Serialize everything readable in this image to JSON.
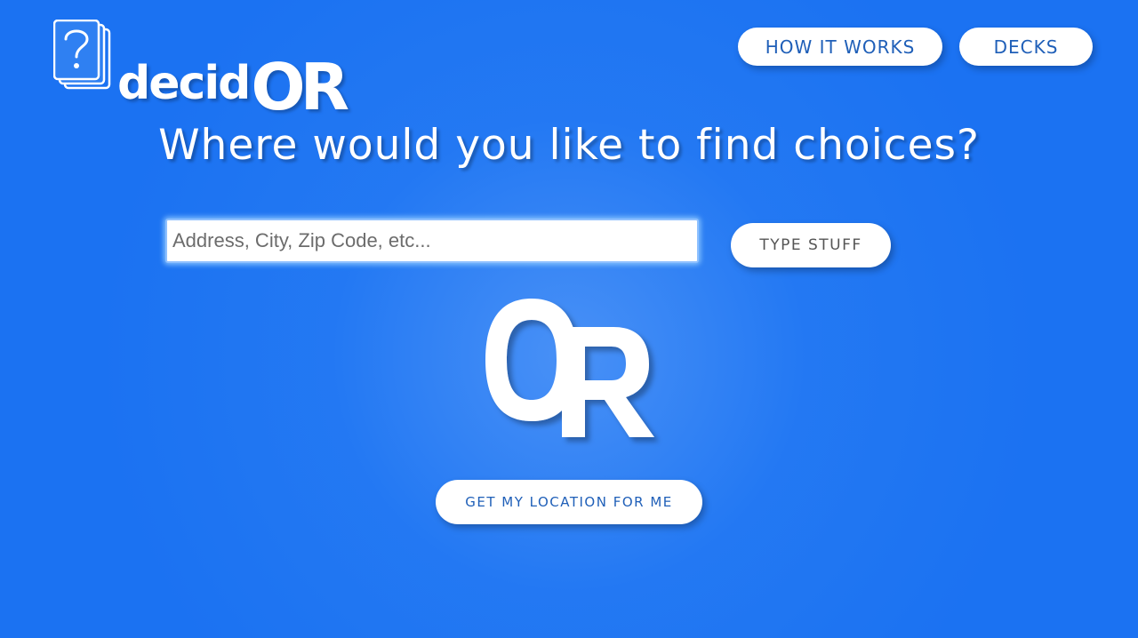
{
  "brand": {
    "name_prefix": "decid",
    "name_suffix": "OR",
    "logo_icon": "question-cards-icon"
  },
  "nav": {
    "how_it_works": "HOW IT WORKS",
    "decks": "DECKS"
  },
  "main": {
    "heading": "Where would you like to find choices?",
    "search": {
      "placeholder": "Address, City, Zip Code, etc...",
      "value": ""
    },
    "type_button": "TYPE STUFF",
    "or_mark": "OR",
    "location_button": "GET MY LOCATION FOR ME"
  },
  "colors": {
    "background": "#2f80f2",
    "button_text": "#1f5fb8",
    "button_bg": "#ffffff",
    "input_glow": "#8ec0ff"
  }
}
